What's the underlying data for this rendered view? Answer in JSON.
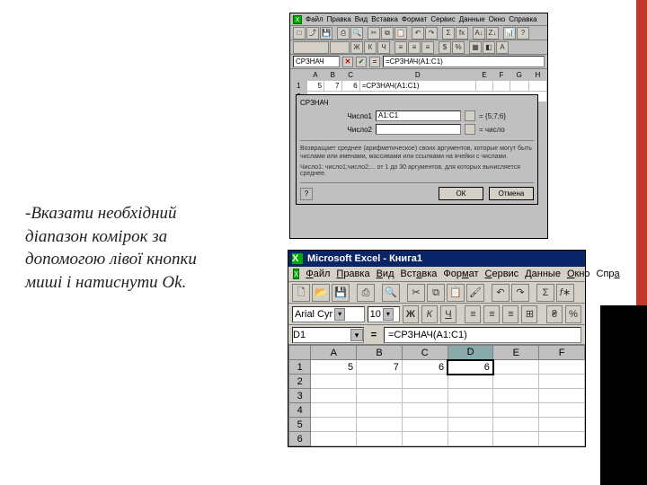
{
  "instruction_text": "-Вказати необхідний діапазон комірок за допомогою лівої кнопки миші і натиснути Ok.",
  "top": {
    "menus": [
      "Файл",
      "Правка",
      "Вид",
      "Вставка",
      "Формат",
      "Сервис",
      "Данные",
      "Окно",
      "Справка"
    ],
    "namebox": "СРЗНАЧ",
    "formula": "=СРЗНАЧ(A1:C1)",
    "headers": [
      "",
      "A",
      "B",
      "C",
      "D",
      "E",
      "F",
      "G",
      "H"
    ],
    "row1": [
      "1",
      "5",
      "7",
      "6",
      "=СРЗНАЧ(A1:C1)",
      "",
      "",
      "",
      ""
    ],
    "dlg": {
      "title": "СРЗНАЧ",
      "field1_label": "Число1",
      "field1_value": "A1:C1",
      "field1_result": "= {5;7;6}",
      "field2_label": "Число2",
      "field2_value": "",
      "field2_hint": "= число",
      "help_text": "Возвращает среднее (арифметическое) своих аргументов, которые могут быть числами или именами, массивами или ссылками на ячейки с числами.",
      "hint_text": "Число1: число1;число2;... от 1 до 30 аргументов, для которых вычисляется среднее.",
      "q_label": "?",
      "ok_label": "ОК",
      "cancel_label": "Отмена"
    }
  },
  "bottom": {
    "title": "Microsoft Excel - Книга1",
    "menus": [
      "Файл",
      "Правка",
      "Вид",
      "Вставка",
      "Формат",
      "Сервис",
      "Данные",
      "Окно",
      "Спра"
    ],
    "font_name": "Arial Cyr",
    "font_size": "10",
    "bold": "Ж",
    "italic": "К",
    "underline": "Ч",
    "pct": "%",
    "cell_ref": "D1",
    "formula": "=СРЗНАЧ(A1:C1)",
    "cols": [
      "",
      "A",
      "B",
      "C",
      "D",
      "E",
      "F"
    ],
    "rows": [
      {
        "n": "1",
        "cells": [
          "5",
          "7",
          "6",
          "6",
          "",
          ""
        ]
      },
      {
        "n": "2",
        "cells": [
          "",
          "",
          "",
          "",
          "",
          ""
        ]
      },
      {
        "n": "3",
        "cells": [
          "",
          "",
          "",
          "",
          "",
          ""
        ]
      },
      {
        "n": "4",
        "cells": [
          "",
          "",
          "",
          "",
          "",
          ""
        ]
      },
      {
        "n": "5",
        "cells": [
          "",
          "",
          "",
          "",
          "",
          ""
        ]
      },
      {
        "n": "6",
        "cells": [
          "",
          "",
          "",
          "",
          "",
          ""
        ]
      }
    ]
  }
}
